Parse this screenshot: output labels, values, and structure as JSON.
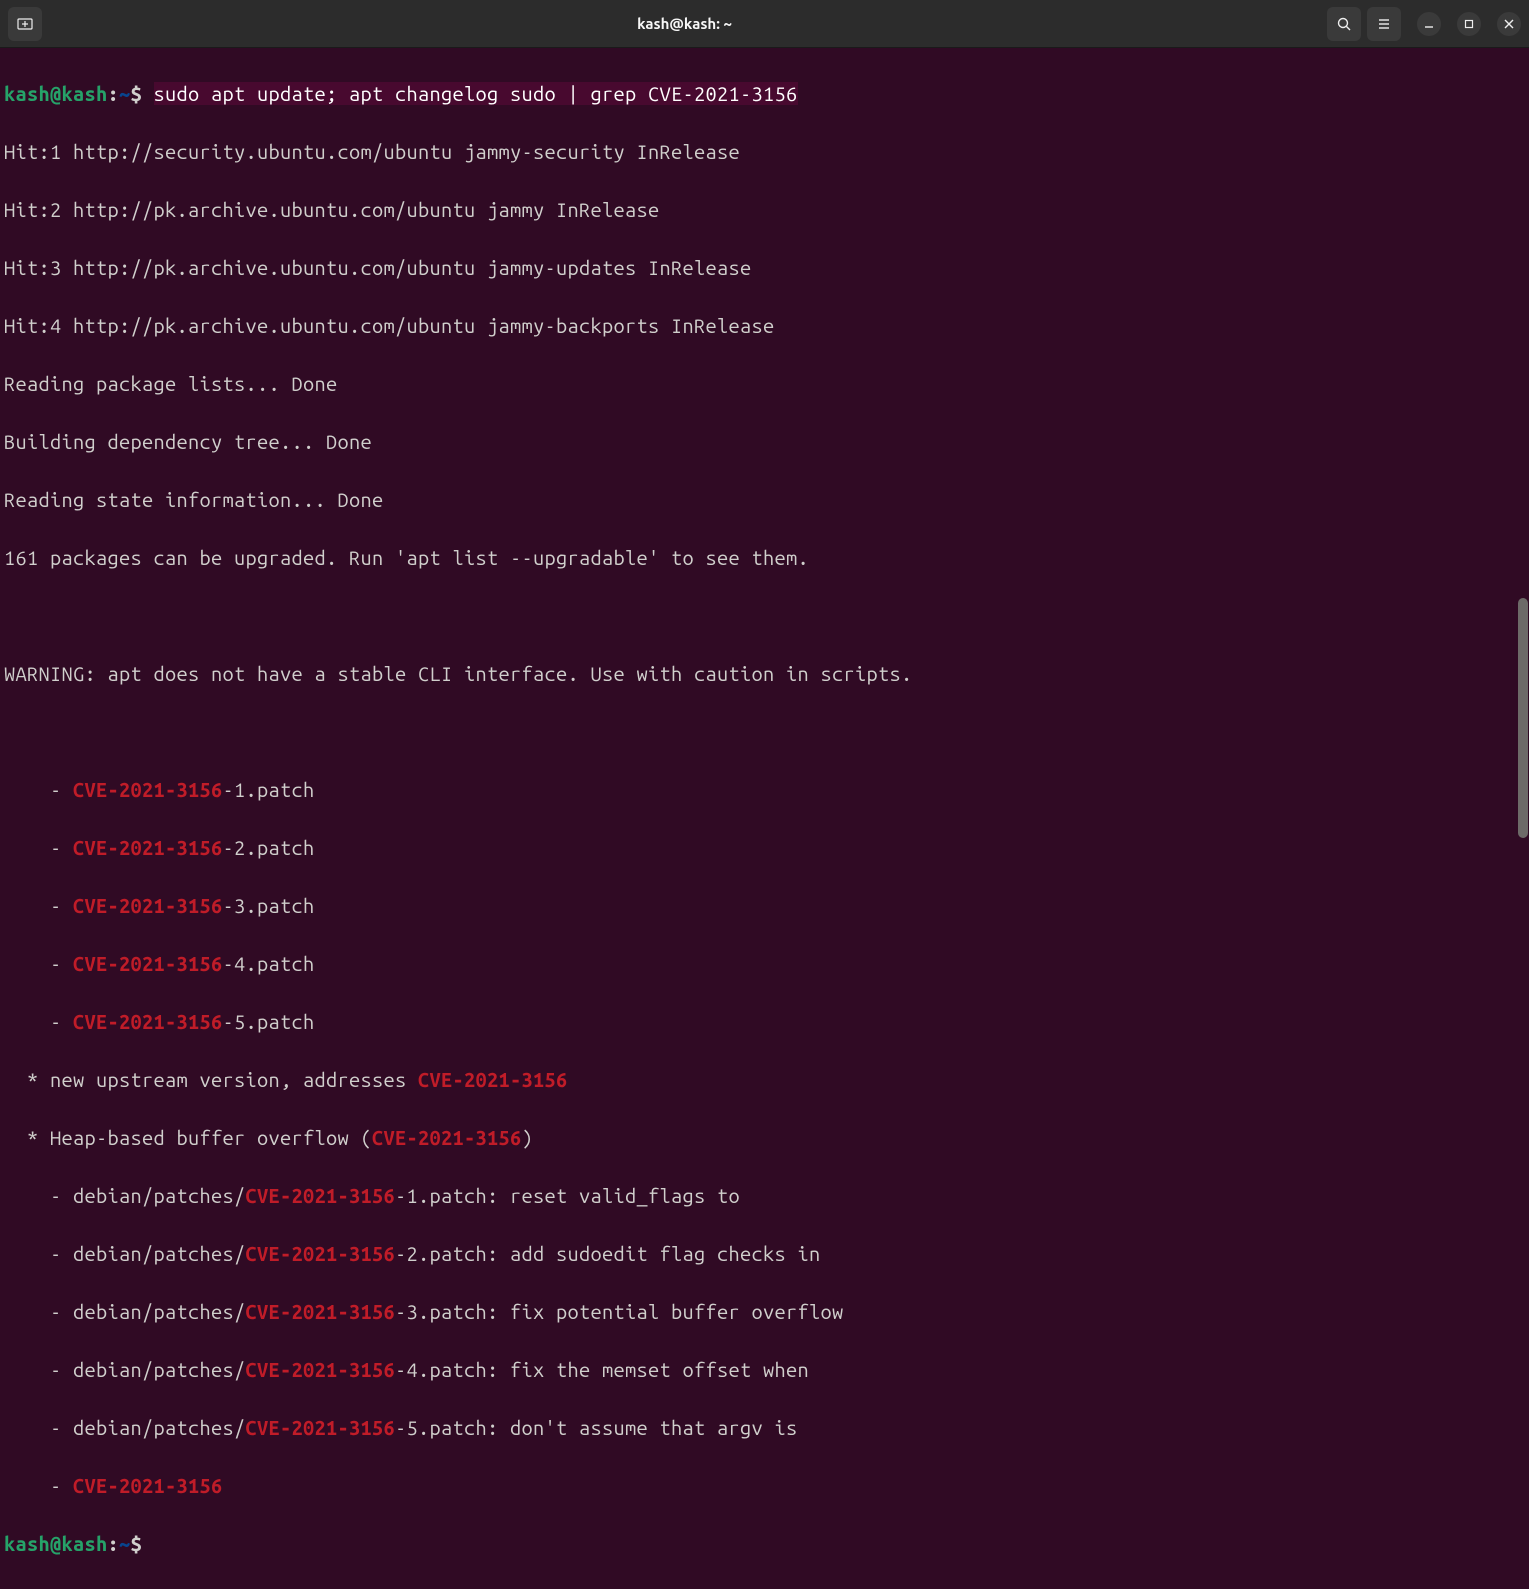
{
  "titlebar": {
    "title": "kash@kash: ~"
  },
  "prompt": {
    "user": "kash",
    "at": "@",
    "host": "kash",
    "colon": ":",
    "path": "~",
    "dollar": "$ "
  },
  "command": "sudo apt update; apt changelog sudo | grep CVE-2021-3156",
  "output": {
    "hit1": "Hit:1 http://security.ubuntu.com/ubuntu jammy-security InRelease",
    "hit2": "Hit:2 http://pk.archive.ubuntu.com/ubuntu jammy InRelease",
    "hit3": "Hit:3 http://pk.archive.ubuntu.com/ubuntu jammy-updates InRelease",
    "hit4": "Hit:4 http://pk.archive.ubuntu.com/ubuntu jammy-backports InRelease",
    "reading_pkg": "Reading package lists... Done",
    "building": "Building dependency tree... Done",
    "reading_state": "Reading state information... Done",
    "upgradable": "161 packages can be upgraded. Run 'apt list --upgradable' to see them.",
    "blank": "",
    "warning": "WARNING: apt does not have a stable CLI interface. Use with caution in scripts.",
    "blank2": ""
  },
  "grep": {
    "patch_prefix": "    - ",
    "cve": "CVE-2021-3156",
    "patch1_suffix": "-1.patch",
    "patch2_suffix": "-2.patch",
    "patch3_suffix": "-3.patch",
    "patch4_suffix": "-4.patch",
    "patch5_suffix": "-5.patch",
    "upstream_pre": "  * new upstream version, addresses ",
    "heap_pre": "  * Heap-based buffer overflow (",
    "heap_post": ")",
    "deb_prefix": "    - debian/patches/",
    "deb1_suffix": "-1.patch: reset valid_flags to",
    "deb2_suffix": "-2.patch: add sudoedit flag checks in",
    "deb3_suffix": "-3.patch: fix potential buffer overflow",
    "deb4_suffix": "-4.patch: fix the memset offset when",
    "deb5_suffix": "-5.patch: don't assume that argv is",
    "last_prefix": "    - "
  }
}
